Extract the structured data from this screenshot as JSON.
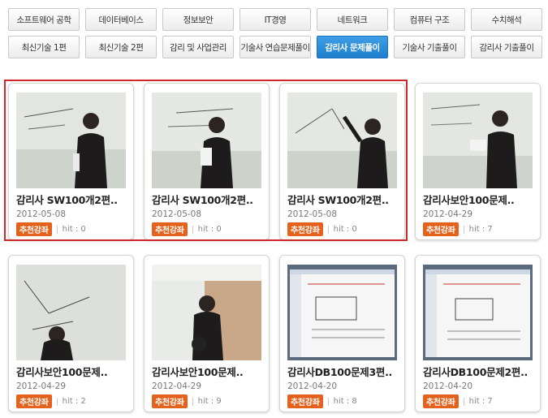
{
  "tabs": {
    "row1": [
      "소프트웨어 공학",
      "데이터베이스",
      "정보보안",
      "IT경영",
      "네트워크",
      "컴퓨터 구조",
      "수치해석"
    ],
    "row2": [
      "최신기술 1편",
      "최신기술 2편",
      "감리 및 사업관리",
      "기술사 연습문제풀이",
      "감리사 문제풀이",
      "기술사 기출풀이",
      "감리사 기출풀이"
    ],
    "active": "감리사 문제풀이"
  },
  "cards": [
    {
      "title": "감리사 SW100개2편..",
      "date": "2012-05-08",
      "badge": "추천강좌",
      "hit": "hit : 0",
      "thumb": "whiteboard-person"
    },
    {
      "title": "감리사 SW100개2편..",
      "date": "2012-05-08",
      "badge": "추천강좌",
      "hit": "hit : 0",
      "thumb": "whiteboard-person"
    },
    {
      "title": "감리사 SW100개2편..",
      "date": "2012-05-08",
      "badge": "추천강좌",
      "hit": "hit : 0",
      "thumb": "whiteboard-person"
    },
    {
      "title": "감리사보안100문제..",
      "date": "2012-04-29",
      "badge": "추천강좌",
      "hit": "hit : 7",
      "thumb": "whiteboard-person"
    },
    {
      "title": "감리사보안100문제..",
      "date": "2012-04-29",
      "badge": "추천강좌",
      "hit": "hit : 2",
      "thumb": "whiteboard-person"
    },
    {
      "title": "감리사보안100문제..",
      "date": "2012-04-29",
      "badge": "추천강좌",
      "hit": "hit : 9",
      "thumb": "whiteboard-person"
    },
    {
      "title": "감리사DB100문제3편..",
      "date": "2012-04-20",
      "badge": "추천강좌",
      "hit": "hit : 8",
      "thumb": "document-screen"
    },
    {
      "title": "감리사DB100문제2편..",
      "date": "2012-04-20",
      "badge": "추천강좌",
      "hit": "hit : 7",
      "thumb": "document-screen"
    }
  ],
  "colors": {
    "accent": "#1f7fcd",
    "badge": "#e5621c",
    "highlight": "#cc2a2a"
  }
}
